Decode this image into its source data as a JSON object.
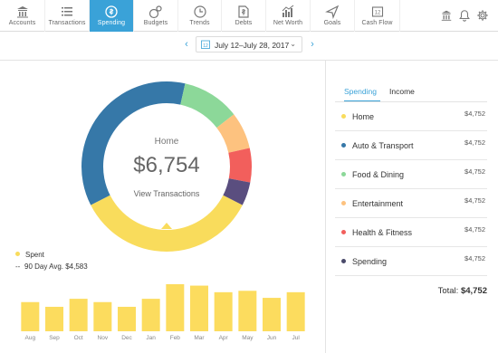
{
  "nav": {
    "items": [
      {
        "label": "Accounts",
        "icon": "bank-icon"
      },
      {
        "label": "Transactions",
        "icon": "list-icon"
      },
      {
        "label": "Spending",
        "icon": "spending-icon"
      },
      {
        "label": "Budgets",
        "icon": "budgets-icon"
      },
      {
        "label": "Trends",
        "icon": "clock-icon"
      },
      {
        "label": "Debts",
        "icon": "debts-icon"
      },
      {
        "label": "Net Worth",
        "icon": "net-worth-icon"
      },
      {
        "label": "Goals",
        "icon": "goals-icon"
      },
      {
        "label": "Cash Flow",
        "icon": "cash-flow-icon"
      }
    ],
    "active": "Spending",
    "right_icons": [
      "bank-icon",
      "bell-icon",
      "gear-icon"
    ]
  },
  "date_range": {
    "label": "July 12–July 28, 2017",
    "calendar_day": "12"
  },
  "donut": {
    "center_category": "Home",
    "center_amount": "$6,754",
    "link": "View Transactions"
  },
  "legend": {
    "spent": "Spent",
    "avg": "90 Day Avg. $4,583"
  },
  "colors": {
    "accent": "#3aa2d8",
    "home": "#f9dc5c",
    "auto": "#3678a8",
    "food": "#8cd899",
    "entertainment": "#fdc27f",
    "health": "#f25f5c",
    "spending": "#5a4e7f",
    "bar": "#fcdc5e"
  },
  "chart_data": {
    "type": "bar",
    "categories": [
      "Aug",
      "Sep",
      "Oct",
      "Nov",
      "Dec",
      "Jan",
      "Feb",
      "Mar",
      "Apr",
      "May",
      "Jun",
      "Jul"
    ],
    "values": [
      0.62,
      0.52,
      0.69,
      0.62,
      0.52,
      0.69,
      1.0,
      0.97,
      0.83,
      0.86,
      0.71,
      0.83
    ],
    "title": "",
    "xlabel": "",
    "ylabel": ""
  },
  "donut_data": {
    "type": "pie",
    "segments": [
      {
        "name": "Auto & Transport",
        "value": 36
      },
      {
        "name": "Food & Dining",
        "value": 11
      },
      {
        "name": "Entertainment",
        "value": 7
      },
      {
        "name": "Health & Fitness",
        "value": 6.5
      },
      {
        "name": "Spending",
        "value": 4.5
      },
      {
        "name": "Home",
        "value": 35
      }
    ]
  },
  "panel": {
    "tabs": {
      "spending": "Spending",
      "income": "Income"
    },
    "categories": [
      {
        "name": "Home",
        "amount": "$4,752",
        "color": "#f9dc5c"
      },
      {
        "name": "Auto & Transport",
        "amount": "$4,752",
        "color": "#3678a8"
      },
      {
        "name": "Food & Dining",
        "amount": "$4,752",
        "color": "#8cd899"
      },
      {
        "name": "Entertainment",
        "amount": "$4,752",
        "color": "#fdc27f"
      },
      {
        "name": "Health & Fitness",
        "amount": "$4,752",
        "color": "#f25f5c"
      },
      {
        "name": "Spending",
        "amount": "$4,752",
        "color": "#4a4a6a"
      }
    ],
    "total_label": "Total:",
    "total_amount": "$4,752"
  }
}
